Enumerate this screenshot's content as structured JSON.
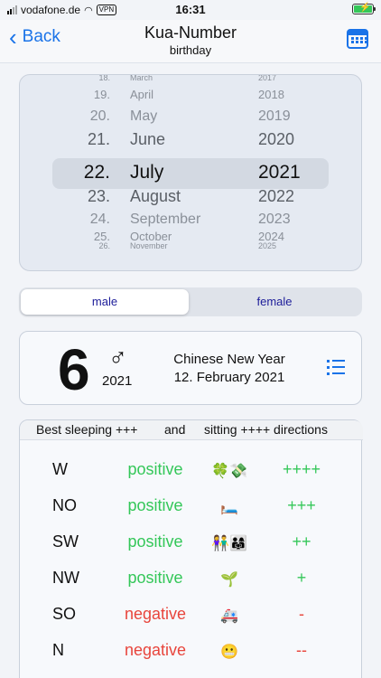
{
  "status_bar": {
    "carrier": "vodafone.de",
    "vpn": "VPN",
    "time": "16:31",
    "battery_level": 1.0,
    "colors": {
      "battery": "#34c759"
    }
  },
  "nav": {
    "back_label": "Back",
    "title": "Kua-Number",
    "subtitle": "birthday"
  },
  "picker": {
    "rows": [
      {
        "day": "18.",
        "month": "March",
        "year": "2017"
      },
      {
        "day": "19.",
        "month": "April",
        "year": "2018"
      },
      {
        "day": "20.",
        "month": "May",
        "year": "2019"
      },
      {
        "day": "21.",
        "month": "June",
        "year": "2020"
      },
      {
        "day": "22.",
        "month": "July",
        "year": "2021"
      },
      {
        "day": "23.",
        "month": "August",
        "year": "2022"
      },
      {
        "day": "24.",
        "month": "September",
        "year": "2023"
      },
      {
        "day": "25.",
        "month": "October",
        "year": "2024"
      },
      {
        "day": "26.",
        "month": "November",
        "year": "2025"
      }
    ],
    "selected_index": 4
  },
  "segment": {
    "male": "male",
    "female": "female",
    "selected": "male"
  },
  "kua": {
    "number": "6",
    "gender_symbol": "♂",
    "year": "2021",
    "cny_title": "Chinese New Year",
    "cny_date": "12. February 2021"
  },
  "directions": {
    "header": {
      "part1": "Best sleeping +++",
      "part2": "and",
      "part3": "sitting ++++ directions"
    },
    "rows": [
      {
        "dir": "W",
        "quality": "positive",
        "emoji": "🍀💸",
        "strength": "++++"
      },
      {
        "dir": "NO",
        "quality": "positive",
        "emoji": "🛏️",
        "strength": "+++"
      },
      {
        "dir": "SW",
        "quality": "positive",
        "emoji": "👫👨‍👩‍👧",
        "strength": "++"
      },
      {
        "dir": "NW",
        "quality": "positive",
        "emoji": "🌱",
        "strength": "+"
      },
      {
        "dir": "SO",
        "quality": "negative",
        "emoji": "🚑",
        "strength": "-"
      },
      {
        "dir": "N",
        "quality": "negative",
        "emoji": "😬",
        "strength": "--"
      }
    ],
    "colors": {
      "positive": "#34c759",
      "negative": "#e8453c"
    }
  },
  "colors": {
    "accent": "#1a73e8",
    "segment_text": "#1c1c99"
  }
}
